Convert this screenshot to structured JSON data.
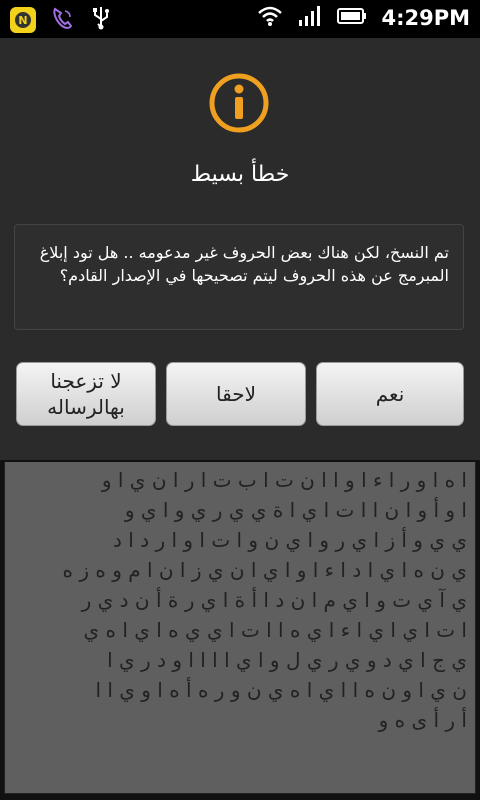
{
  "status_bar": {
    "time": "4:29PM",
    "icons_left": [
      "app-badge-icon",
      "viber-icon",
      "usb-icon"
    ],
    "icons_right": [
      "wifi-icon",
      "signal-icon",
      "battery-icon"
    ]
  },
  "dialog": {
    "icon": "info-icon",
    "title": "خطأ بسيط",
    "message": "تم النسخ، لكن هناك بعض الحروف غير مدعومه .. هل تود إبلاغ المبرمج عن هذه الحروف ليتم تصحيحها في الإصدار القادم؟",
    "buttons": {
      "yes": "نعم",
      "later": "لاحقا",
      "dont_bother": "لا تزعجنا بهالرساله"
    }
  },
  "background_text": [
    "ا ه ا و ر ا ء ا و ا ا ن ت ا ب ت ا ر ا ن ي ا و",
    "ا و أ و ا ن ا ا ت ا ي ا ة ي ي ر ي و ا ي و",
    "ي ي و أ ز ا ي ر و ا ي ن و ا ت ا و ا ر د ا د",
    "ي ن ه ا ي ا د ا ء ا و ا ي ا ن ي ز ا ن ا م و ه ز ه",
    "ي آ ي ت و ا ي م ا ن د ا أ ة ا ي ر ة أ ن د ي ر",
    "ا ت ا ي ا ي ا ء ا ي ه ا ا ت ا ي ي ه ا ي ا ه ي",
    "ي ج ا ي د و ي ر ي ل و ا ي ا ا ا ا و د ر ي ا",
    "ن ي ا و ن ه ا ا ي ا ه ي ن و ر ه أ ه ا و ي ا ا",
    "أ ر أ ى ه و"
  ],
  "colors": {
    "accent": "#f0a020",
    "dialog_bg": "#2b2b2b",
    "background_paper": "#5f5f5f"
  }
}
